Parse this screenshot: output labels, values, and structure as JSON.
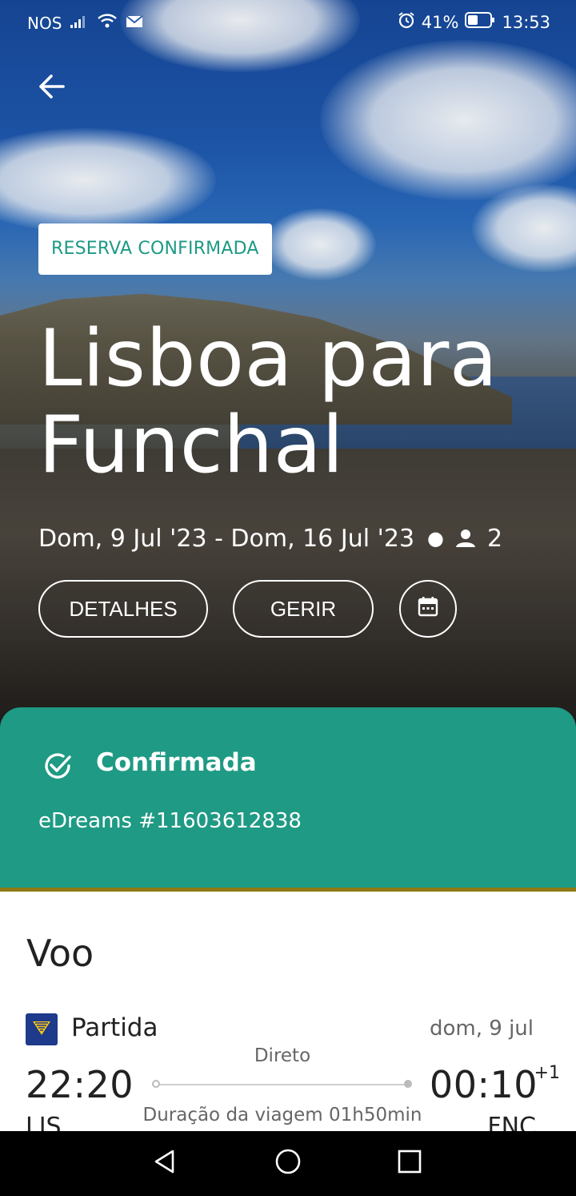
{
  "status_bar": {
    "carrier": "NOS",
    "battery": "41%",
    "time": "13:53"
  },
  "hero": {
    "badge": "RESERVA CONFIRMADA",
    "title_line1": "Lisboa para",
    "title_line2": "Funchal",
    "dates": "Dom, 9 Jul '23 - Dom, 16 Jul '23",
    "passengers": "2",
    "details_button": "DETALHES",
    "manage_button": "GERIR"
  },
  "confirmation": {
    "title": "Confirmada",
    "reference": "eDreams #11603612838",
    "color": "#1f9a84"
  },
  "flight": {
    "section_title": "Voo",
    "leg_label": "Partida",
    "date": "dom, 9 jul",
    "stops": "Direto",
    "departure_time": "22:20",
    "arrival_time": "00:10",
    "day_offset": "+1",
    "duration": "Duração da viagem 01h50min",
    "departure_code": "LIS",
    "arrival_code": "FNC"
  }
}
